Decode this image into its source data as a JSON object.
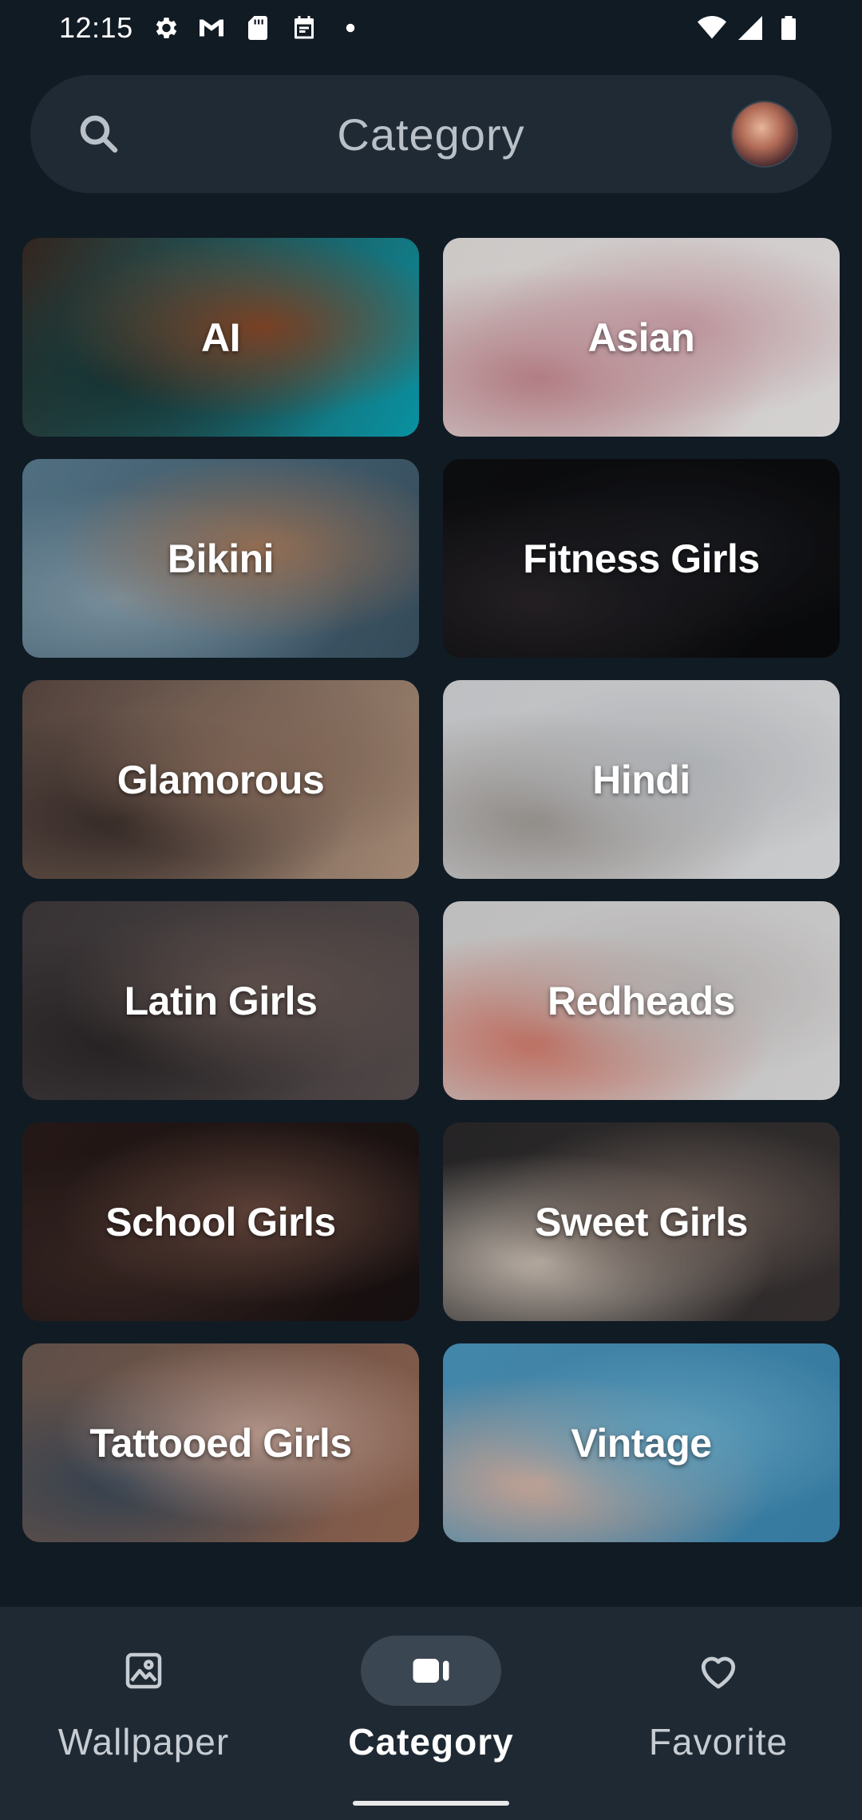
{
  "status_bar": {
    "time": "12:15",
    "left_icons": [
      "gear-icon",
      "gmail-icon",
      "sd-card-icon",
      "calendar-icon",
      "dot-icon"
    ],
    "right_icons": [
      "wifi-icon",
      "signal-icon",
      "battery-icon"
    ]
  },
  "search": {
    "title": "Category",
    "icon": "search-icon"
  },
  "categories": [
    {
      "label": "AI",
      "colors": [
        "#3a2a22",
        "#8a4a2a",
        "#1a3a3a",
        "#0aa6b8"
      ]
    },
    {
      "label": "Asian",
      "colors": [
        "#e9e4e2",
        "#d7a9b1",
        "#c98b93",
        "#f2eeee"
      ]
    },
    {
      "label": "Bikini",
      "colors": [
        "#5b7f93",
        "#a77c5e",
        "#8aa3b2",
        "#3c5566"
      ]
    },
    {
      "label": "Fitness Girls",
      "colors": [
        "#0e0f12",
        "#1c1d22",
        "#2a2529",
        "#0b0c0e"
      ]
    },
    {
      "label": "Glamorous",
      "colors": [
        "#5c4a44",
        "#8e7160",
        "#3a2e2b",
        "#b89a83"
      ]
    },
    {
      "label": "Hindi",
      "colors": [
        "#d8dadd",
        "#c5c8cc",
        "#a39d98",
        "#e6e7e9"
      ]
    },
    {
      "label": "Latin Girls",
      "colors": [
        "#3f3a3c",
        "#6a5a55",
        "#2a2627",
        "#5a5050"
      ]
    },
    {
      "label": "Redheads",
      "colors": [
        "#d9d8d8",
        "#c9c4c3",
        "#d87a6a",
        "#e5e4e4"
      ]
    },
    {
      "label": "School Girls",
      "colors": [
        "#2a1c1a",
        "#6a4a40",
        "#3c2a26",
        "#1a1212"
      ]
    },
    {
      "label": "Sweet Girls",
      "colors": [
        "#2b2a2b",
        "#7a6a62",
        "#d5c9bd",
        "#3a3434"
      ]
    },
    {
      "label": "Tattooed Girls",
      "colors": [
        "#6b5a52",
        "#c9a79a",
        "#3b4a5a",
        "#9a6a55"
      ]
    },
    {
      "label": "Vintage",
      "colors": [
        "#4d9ac2",
        "#6bb2d3",
        "#e2b8a6",
        "#3d8ab5"
      ]
    }
  ],
  "bottom_nav": {
    "items": [
      {
        "label": "Wallpaper",
        "icon": "image-icon",
        "active": false
      },
      {
        "label": "Category",
        "icon": "category-icon",
        "active": true
      },
      {
        "label": "Favorite",
        "icon": "heart-icon",
        "active": false
      }
    ]
  }
}
